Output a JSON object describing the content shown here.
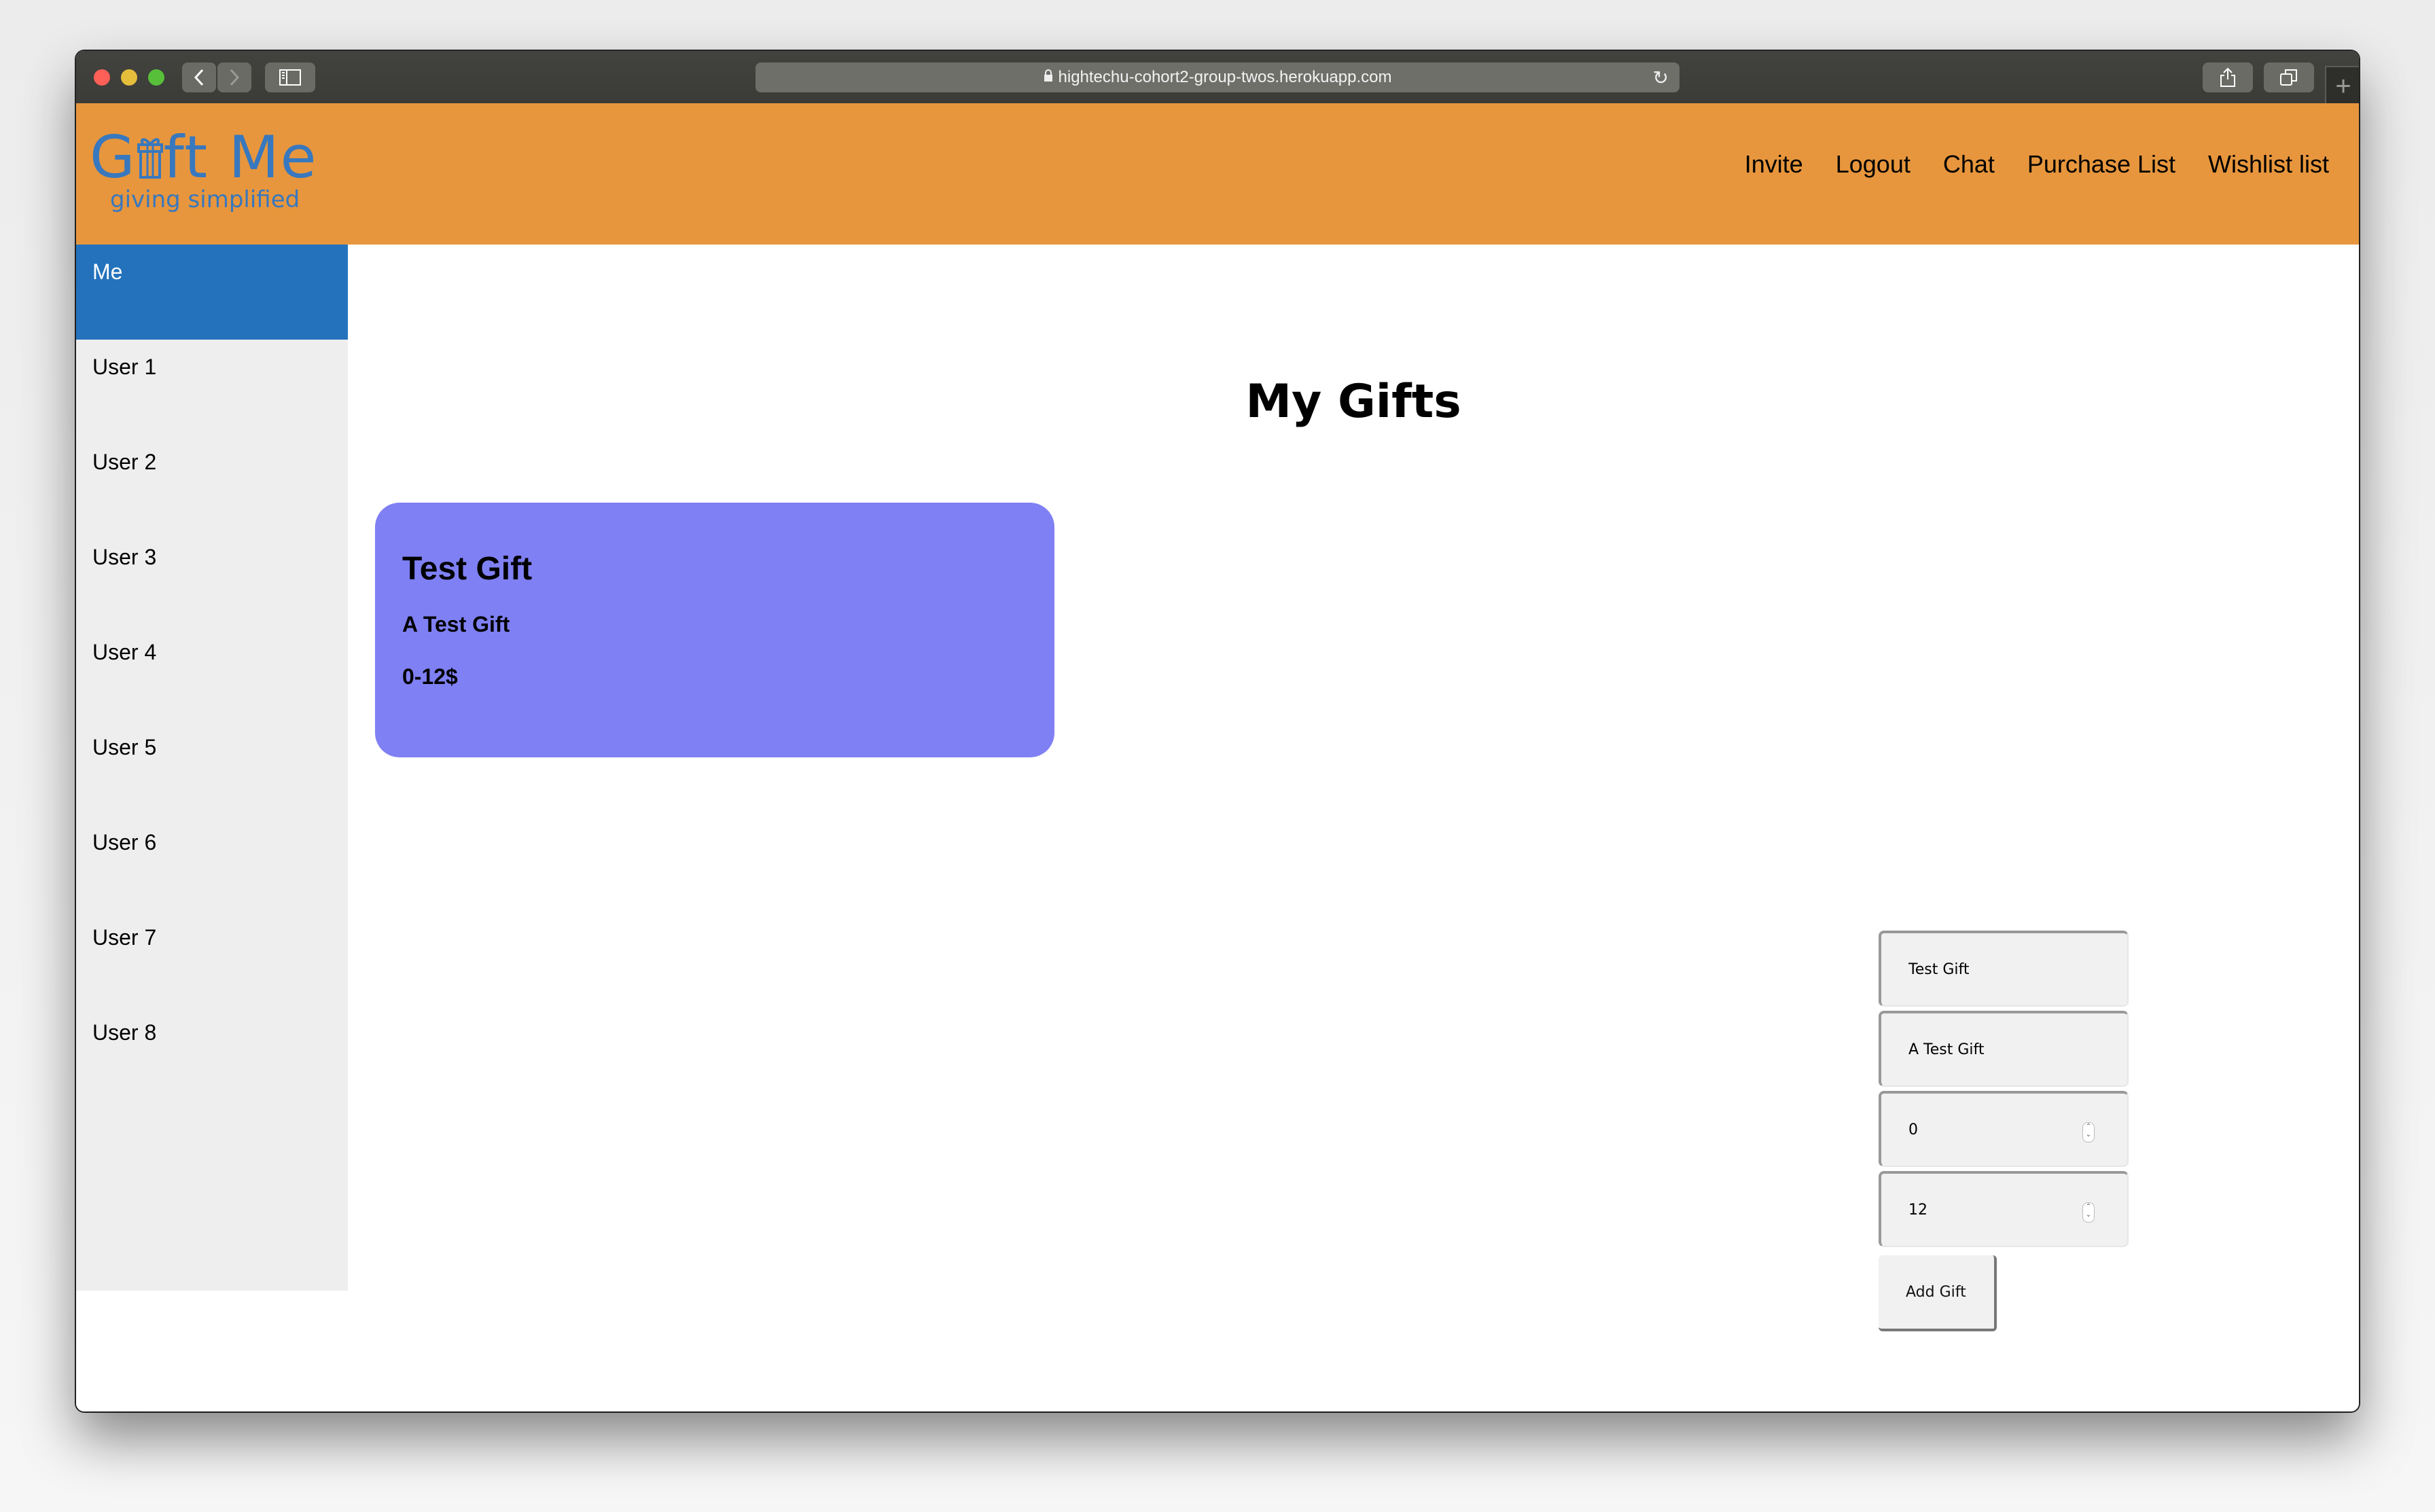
{
  "browser": {
    "url": "hightechu-cohort2-group-twos.herokuapp.com",
    "icons": {
      "back": "chevron-left-icon",
      "forward": "chevron-right-icon",
      "sidebar": "sidebar-icon",
      "lock": "lock-icon",
      "reload": "reload-icon",
      "share": "share-icon",
      "tabs": "tabs-icon",
      "new_tab": "plus-icon"
    }
  },
  "header": {
    "logo_main": "G ft Me",
    "logo_tagline": "giving simplified",
    "logo_icon": "gift-box-icon",
    "nav": [
      "Invite",
      "Logout",
      "Chat",
      "Purchase List",
      "Wishlist list"
    ]
  },
  "sidebar": {
    "items": [
      {
        "label": "Me",
        "active": true
      },
      {
        "label": "User 1"
      },
      {
        "label": "User 2"
      },
      {
        "label": "User 3"
      },
      {
        "label": "User 4"
      },
      {
        "label": "User 5"
      },
      {
        "label": "User 6"
      },
      {
        "label": "User 7"
      },
      {
        "label": "User 8"
      }
    ]
  },
  "main": {
    "title": "My Gifts",
    "gifts": [
      {
        "name": "Test Gift",
        "description": "A Test Gift",
        "price": "0-12$"
      }
    ]
  },
  "form": {
    "name_value": "Test Gift",
    "description_value": "A Test Gift",
    "min_price_value": "0",
    "max_price_value": "12",
    "submit_label": "Add Gift"
  },
  "colors": {
    "header_bg": "#e7963d",
    "logo": "#3878be",
    "active_sidebar": "#2472bc",
    "sidebar_bg": "#eeeeee",
    "gift_card": "#7f80f4"
  }
}
